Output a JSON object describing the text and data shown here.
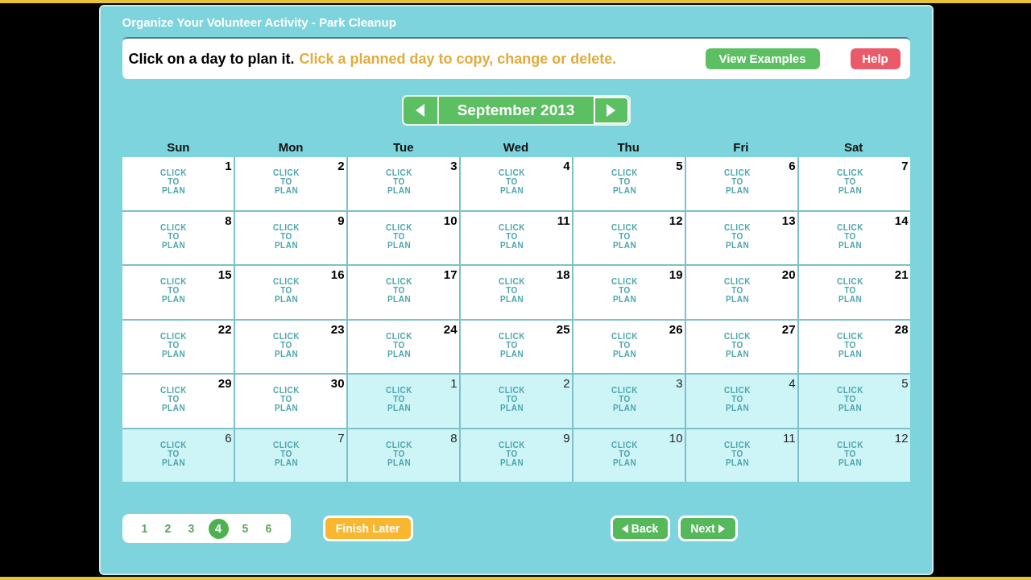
{
  "window": {
    "title": "Organize Your Volunteer Activity - Park Cleanup"
  },
  "instructions": {
    "text": "Click on a day to plan it.",
    "hint": "Click a planned day to copy, change or delete."
  },
  "buttons": [
    {
      "label": "View Examples",
      "kind": "examples"
    },
    {
      "label": "Help",
      "kind": "help"
    }
  ],
  "month_nav": {
    "label": "September 2013"
  },
  "weekdays": [
    "Sun",
    "Mon",
    "Tue",
    "Wed",
    "Thu",
    "Fri",
    "Sat"
  ],
  "days": [
    {
      "day": "1",
      "action": "CLICK TO PLAN",
      "in_month": true
    },
    {
      "day": "2",
      "action": "CLICK TO PLAN",
      "in_month": true
    },
    {
      "day": "3",
      "action": "CLICK TO PLAN",
      "in_month": true
    },
    {
      "day": "4",
      "action": "CLICK TO PLAN",
      "in_month": true
    },
    {
      "day": "5",
      "action": "CLICK TO PLAN",
      "in_month": true
    },
    {
      "day": "6",
      "action": "CLICK TO PLAN",
      "in_month": true
    },
    {
      "day": "7",
      "action": "CLICK TO PLAN",
      "in_month": true
    },
    {
      "day": "8",
      "action": "CLICK TO PLAN",
      "in_month": true
    },
    {
      "day": "9",
      "action": "CLICK TO PLAN",
      "in_month": true
    },
    {
      "day": "10",
      "action": "CLICK TO PLAN",
      "in_month": true
    },
    {
      "day": "11",
      "action": "CLICK TO PLAN",
      "in_month": true
    },
    {
      "day": "12",
      "action": "CLICK TO PLAN",
      "in_month": true
    },
    {
      "day": "13",
      "action": "CLICK TO PLAN",
      "in_month": true
    },
    {
      "day": "14",
      "action": "CLICK TO PLAN",
      "in_month": true
    },
    {
      "day": "15",
      "action": "CLICK TO PLAN",
      "in_month": true
    },
    {
      "day": "16",
      "action": "CLICK TO PLAN",
      "in_month": true
    },
    {
      "day": "17",
      "action": "CLICK TO PLAN",
      "in_month": true
    },
    {
      "day": "18",
      "action": "CLICK TO PLAN",
      "in_month": true
    },
    {
      "day": "19",
      "action": "CLICK TO PLAN",
      "in_month": true
    },
    {
      "day": "20",
      "action": "CLICK TO PLAN",
      "in_month": true
    },
    {
      "day": "21",
      "action": "CLICK TO PLAN",
      "in_month": true
    },
    {
      "day": "22",
      "action": "CLICK TO PLAN",
      "in_month": true
    },
    {
      "day": "23",
      "action": "CLICK TO PLAN",
      "in_month": true
    },
    {
      "day": "24",
      "action": "CLICK TO PLAN",
      "in_month": true
    },
    {
      "day": "25",
      "action": "CLICK TO PLAN",
      "in_month": true
    },
    {
      "day": "26",
      "action": "CLICK TO PLAN",
      "in_month": true
    },
    {
      "day": "27",
      "action": "CLICK TO PLAN",
      "in_month": true
    },
    {
      "day": "28",
      "action": "CLICK TO PLAN",
      "in_month": true
    },
    {
      "day": "29",
      "action": "CLICK TO PLAN",
      "in_month": true
    },
    {
      "day": "30",
      "action": "CLICK TO PLAN",
      "in_month": true
    },
    {
      "day": "1",
      "action": "CLICK TO PLAN",
      "in_month": false
    },
    {
      "day": "2",
      "action": "CLICK TO PLAN",
      "in_month": false
    },
    {
      "day": "3",
      "action": "CLICK TO PLAN",
      "in_month": false
    },
    {
      "day": "4",
      "action": "CLICK TO PLAN",
      "in_month": false
    },
    {
      "day": "5",
      "action": "CLICK TO PLAN",
      "in_month": false
    },
    {
      "day": "6",
      "action": "CLICK TO PLAN",
      "in_month": false
    },
    {
      "day": "7",
      "action": "CLICK TO PLAN",
      "in_month": false
    },
    {
      "day": "8",
      "action": "CLICK TO PLAN",
      "in_month": false
    },
    {
      "day": "9",
      "action": "CLICK TO PLAN",
      "in_month": false
    },
    {
      "day": "10",
      "action": "CLICK TO PLAN",
      "in_month": false
    },
    {
      "day": "11",
      "action": "CLICK TO PLAN",
      "in_month": false
    },
    {
      "day": "12",
      "action": "CLICK TO PLAN",
      "in_month": false
    }
  ],
  "pager": [
    {
      "label": "1",
      "selected": false
    },
    {
      "label": "2",
      "selected": false
    },
    {
      "label": "3",
      "selected": false
    },
    {
      "label": "4",
      "selected": true
    },
    {
      "label": "5",
      "selected": false
    },
    {
      "label": "6",
      "selected": false
    }
  ],
  "footer_buttons": [
    {
      "label": "Finish Later",
      "kind": "later"
    },
    {
      "label": "Back",
      "kind": "back"
    },
    {
      "label": "Next",
      "kind": "next"
    }
  ]
}
